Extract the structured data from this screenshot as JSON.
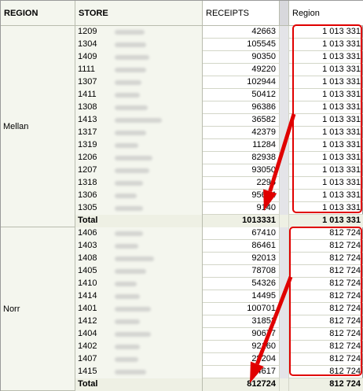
{
  "headers": {
    "region": "REGION",
    "store": "STORE",
    "receipts": "RECEIPTS",
    "region_total": "Region"
  },
  "groups": [
    {
      "region": "Mellan",
      "rows": [
        {
          "store_id": "1209",
          "receipts": "42663",
          "region_total": "1 013 331"
        },
        {
          "store_id": "1304",
          "receipts": "105545",
          "region_total": "1 013 331"
        },
        {
          "store_id": "1409",
          "receipts": "90350",
          "region_total": "1 013 331"
        },
        {
          "store_id": "1111",
          "receipts": "49220",
          "region_total": "1 013 331"
        },
        {
          "store_id": "1307",
          "receipts": "102944",
          "region_total": "1 013 331"
        },
        {
          "store_id": "1411",
          "receipts": "50412",
          "region_total": "1 013 331"
        },
        {
          "store_id": "1308",
          "receipts": "96386",
          "region_total": "1 013 331"
        },
        {
          "store_id": "1413",
          "receipts": "36582",
          "region_total": "1 013 331"
        },
        {
          "store_id": "1317",
          "receipts": "42379",
          "region_total": "1 013 331"
        },
        {
          "store_id": "1319",
          "receipts": "11284",
          "region_total": "1 013 331"
        },
        {
          "store_id": "1206",
          "receipts": "82938",
          "region_total": "1 013 331"
        },
        {
          "store_id": "1207",
          "receipts": "93050",
          "region_total": "1 013 331"
        },
        {
          "store_id": "1318",
          "receipts": "2296",
          "region_total": "1 013 331"
        },
        {
          "store_id": "1306",
          "receipts": "95644",
          "region_total": "1 013 331"
        },
        {
          "store_id": "1305",
          "receipts": "9140",
          "region_total": "1 013 331"
        }
      ],
      "total": {
        "label": "Total",
        "receipts": "1013331",
        "region_total": "1 013 331"
      }
    },
    {
      "region": "Norr",
      "rows": [
        {
          "store_id": "1406",
          "receipts": "67410",
          "region_total": "812 724"
        },
        {
          "store_id": "1403",
          "receipts": "86461",
          "region_total": "812 724"
        },
        {
          "store_id": "1408",
          "receipts": "92013",
          "region_total": "812 724"
        },
        {
          "store_id": "1405",
          "receipts": "78708",
          "region_total": "812 724"
        },
        {
          "store_id": "1410",
          "receipts": "54326",
          "region_total": "812 724"
        },
        {
          "store_id": "1414",
          "receipts": "14495",
          "region_total": "812 724"
        },
        {
          "store_id": "1401",
          "receipts": "100701",
          "region_total": "812 724"
        },
        {
          "store_id": "1412",
          "receipts": "31852",
          "region_total": "812 724"
        },
        {
          "store_id": "1404",
          "receipts": "90677",
          "region_total": "812 724"
        },
        {
          "store_id": "1402",
          "receipts": "92160",
          "region_total": "812 724"
        },
        {
          "store_id": "1407",
          "receipts": "28204",
          "region_total": "812 724"
        },
        {
          "store_id": "1415",
          "receipts": "24617",
          "region_total": "812 724"
        }
      ],
      "total": {
        "label": "Total",
        "receipts": "812724",
        "region_total": "812 724"
      }
    }
  ],
  "annotation_color": "#e00000"
}
